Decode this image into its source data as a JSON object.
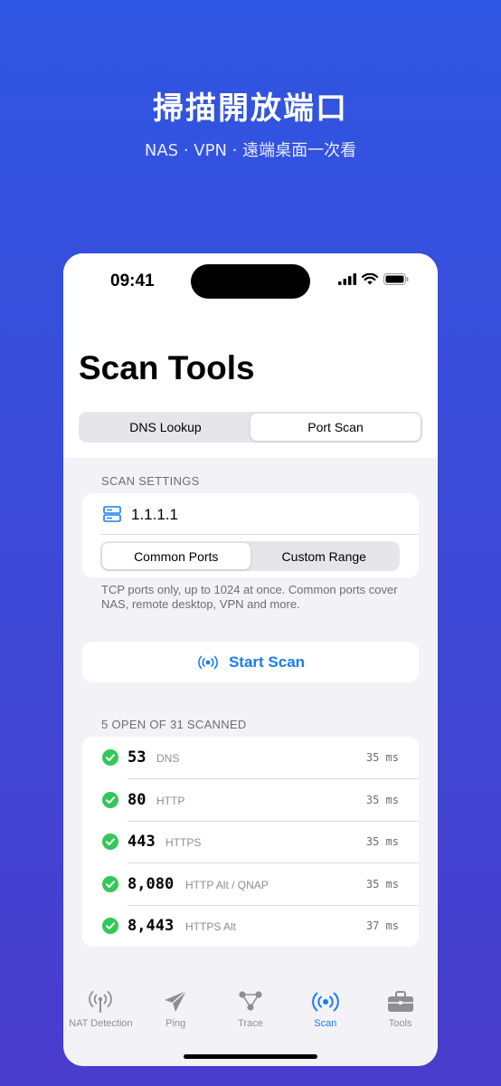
{
  "promo": {
    "title": "掃描開放端口",
    "subtitle": "NAS · VPN · 遠端桌面一次看"
  },
  "status_bar": {
    "time": "09:41"
  },
  "nav": {
    "title": "Scan Tools"
  },
  "mode_tabs": {
    "items": [
      {
        "label": "DNS Lookup",
        "selected": false
      },
      {
        "label": "Port Scan",
        "selected": true
      }
    ]
  },
  "settings": {
    "header": "SCAN SETTINGS",
    "host": "1.1.1.1",
    "range_tabs": [
      {
        "label": "Common Ports",
        "selected": true
      },
      {
        "label": "Custom Range",
        "selected": false
      }
    ],
    "footer": "TCP ports only, up to 1024 at once. Common ports cover NAS, remote desktop, VPN and more."
  },
  "scan_button": {
    "label": "Start Scan"
  },
  "results": {
    "header": "5 OPEN OF 31 SCANNED",
    "rows": [
      {
        "port": "53",
        "service": "DNS",
        "latency": "35 ms"
      },
      {
        "port": "80",
        "service": "HTTP",
        "latency": "35 ms"
      },
      {
        "port": "443",
        "service": "HTTPS",
        "latency": "35 ms"
      },
      {
        "port": "8,080",
        "service": "HTTP Alt / QNAP",
        "latency": "35 ms"
      },
      {
        "port": "8,443",
        "service": "HTTPS Alt",
        "latency": "37 ms"
      }
    ]
  },
  "tabbar": {
    "items": [
      {
        "label": "NAT Detection",
        "icon": "antenna-icon",
        "selected": false
      },
      {
        "label": "Ping",
        "icon": "paperplane-icon",
        "selected": false
      },
      {
        "label": "Trace",
        "icon": "network-nodes-icon",
        "selected": false
      },
      {
        "label": "Scan",
        "icon": "broadcast-icon",
        "selected": true
      },
      {
        "label": "Tools",
        "icon": "briefcase-icon",
        "selected": false
      }
    ]
  },
  "colors": {
    "accent": "#1a7cf0",
    "success": "#34c759",
    "background_top": "#2f56e2",
    "background_bottom": "#4a3ccc"
  }
}
